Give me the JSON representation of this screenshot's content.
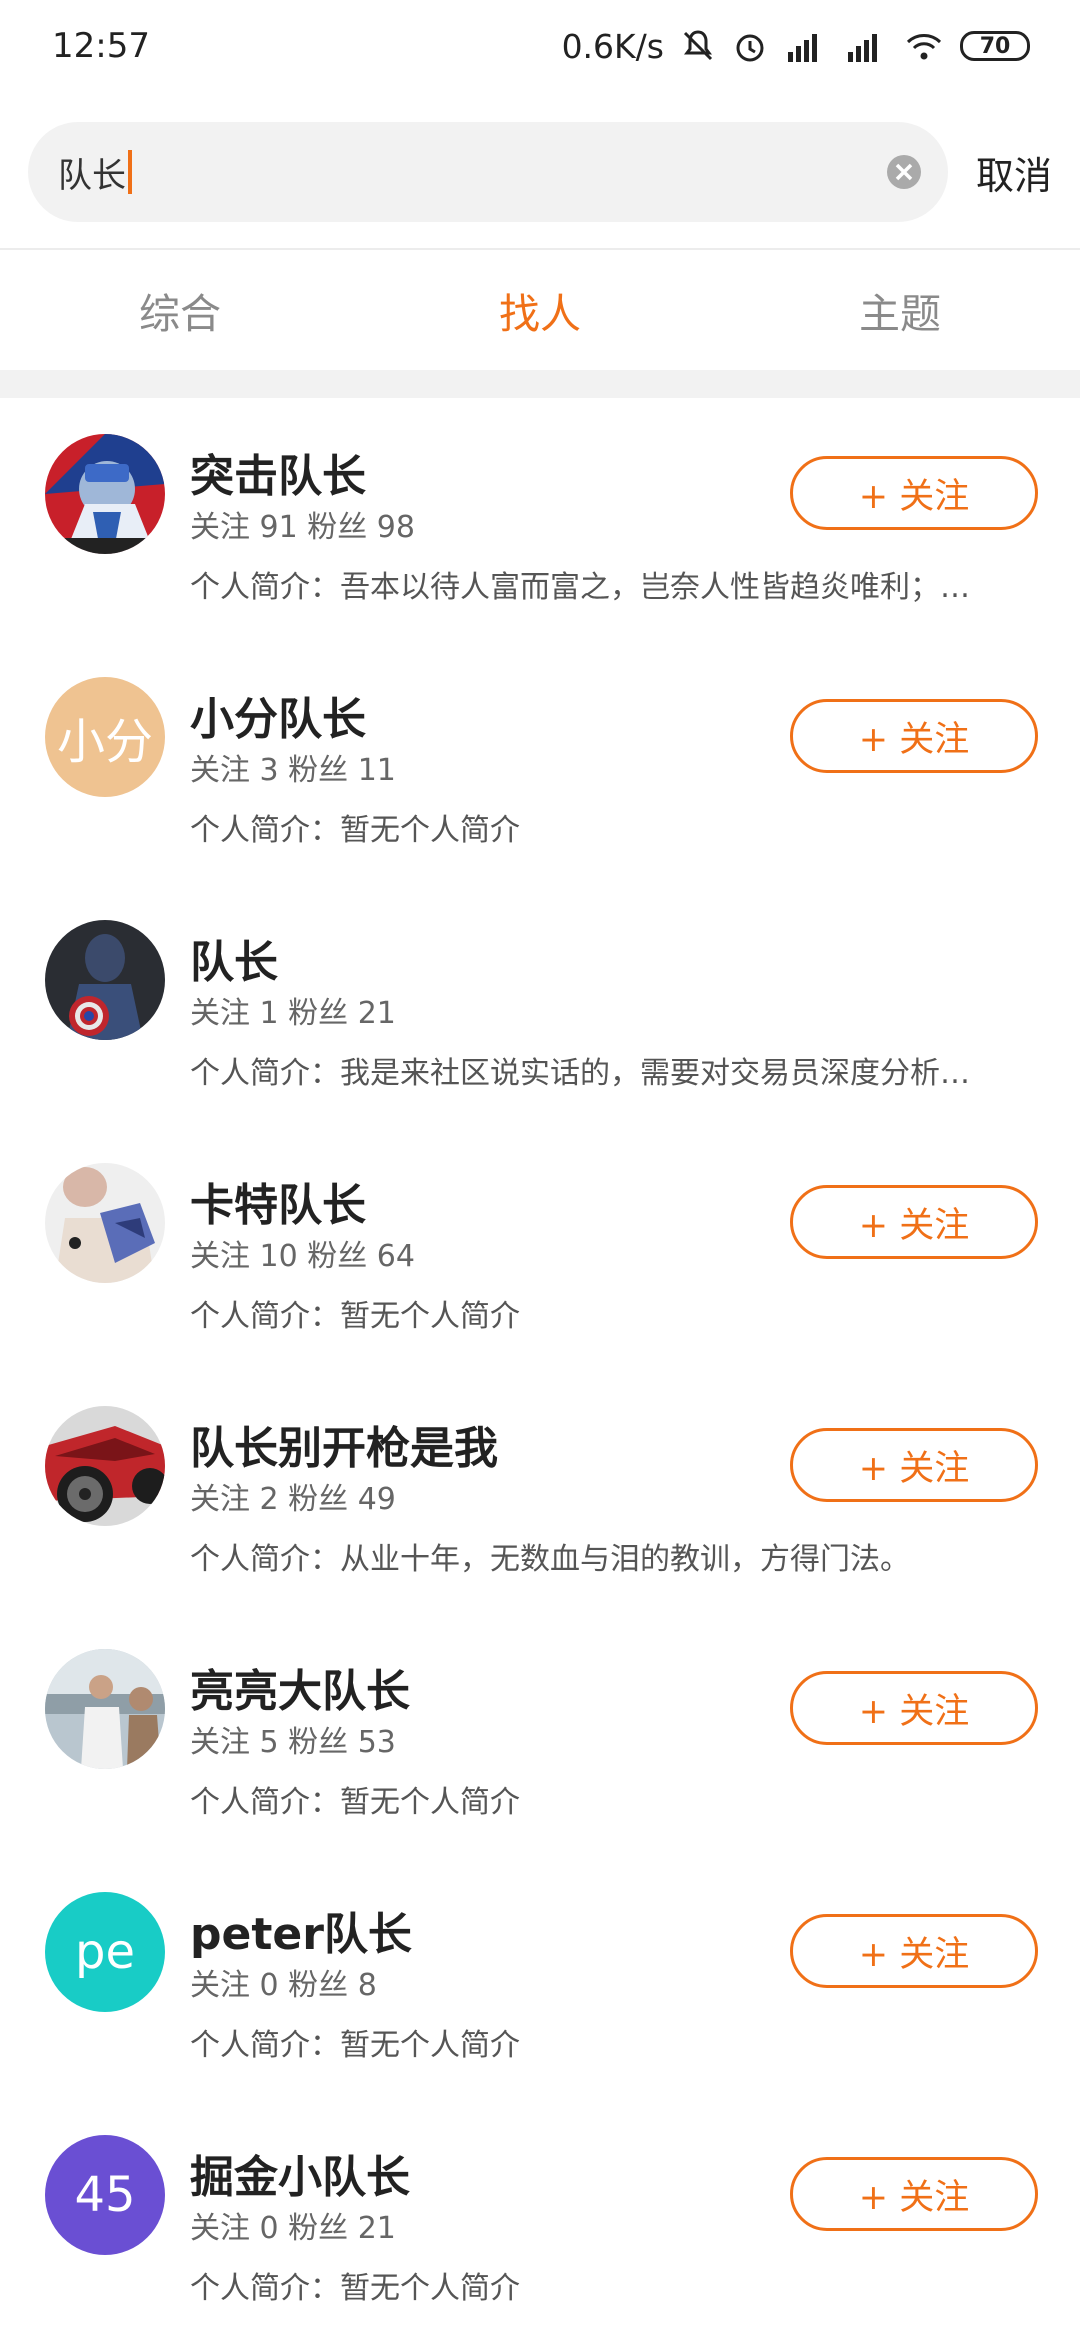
{
  "status_bar": {
    "time": "12:57",
    "speed": "0.6K/s",
    "battery": "70",
    "icons": [
      "bell-muted-icon",
      "alarm-icon",
      "signal-hd-icon",
      "signal-hd-icon",
      "wifi-icon",
      "battery-icon"
    ]
  },
  "search": {
    "query": "队长",
    "cancel_label": "取消"
  },
  "tabs": [
    {
      "label": "综合",
      "active": false
    },
    {
      "label": "找人",
      "active": true
    },
    {
      "label": "主题",
      "active": false
    }
  ],
  "accent_color": "#f07017",
  "users": [
    {
      "name": "突击队长",
      "stats": "关注 91 粉丝 98",
      "bio": "个人简介：吾本以待人富而富之，岂奈人性皆趋炎唯利；…",
      "follow_label": "+ 关注",
      "avatar": {
        "type": "image",
        "desc": "captain-america-comic-avatar"
      }
    },
    {
      "name": "小分队长",
      "stats": "关注 3 粉丝 11",
      "bio": "个人简介：暂无个人简介",
      "follow_label": "+ 关注",
      "avatar": {
        "type": "text",
        "text": "小分",
        "color": "#efc391"
      }
    },
    {
      "name": "队长",
      "stats": "关注 1 粉丝 21",
      "bio": "个人简介：我是来社区说实话的，需要对交易员深度分析…",
      "follow_label": "",
      "avatar": {
        "type": "image",
        "desc": "captain-america-movie-avatar"
      }
    },
    {
      "name": "卡特队长",
      "stats": "关注 10 粉丝 64",
      "bio": "个人简介：暂无个人简介",
      "follow_label": "+ 关注",
      "avatar": {
        "type": "image",
        "desc": "scarf-avatar"
      }
    },
    {
      "name": "队长别开枪是我",
      "stats": "关注 2 粉丝 49",
      "bio": "个人简介：从业十年，无数血与泪的教训，方得门法。",
      "follow_label": "+ 关注",
      "avatar": {
        "type": "image",
        "desc": "red-car-avatar"
      }
    },
    {
      "name": "亮亮大队长",
      "stats": "关注 5 粉丝 53",
      "bio": "个人简介：暂无个人简介",
      "follow_label": "+ 关注",
      "avatar": {
        "type": "image",
        "desc": "person-photo-avatar"
      }
    },
    {
      "name": "peter队长",
      "stats": "关注 0 粉丝 8",
      "bio": "个人简介：暂无个人简介",
      "follow_label": "+ 关注",
      "avatar": {
        "type": "text",
        "text": "pe",
        "color": "#18ccc6"
      }
    },
    {
      "name": "掘金小队长",
      "stats": "关注 0 粉丝 21",
      "bio": "个人简介：暂无个人简介",
      "follow_label": "+ 关注",
      "avatar": {
        "type": "text",
        "text": "45",
        "color": "#6a4fd3"
      }
    }
  ]
}
